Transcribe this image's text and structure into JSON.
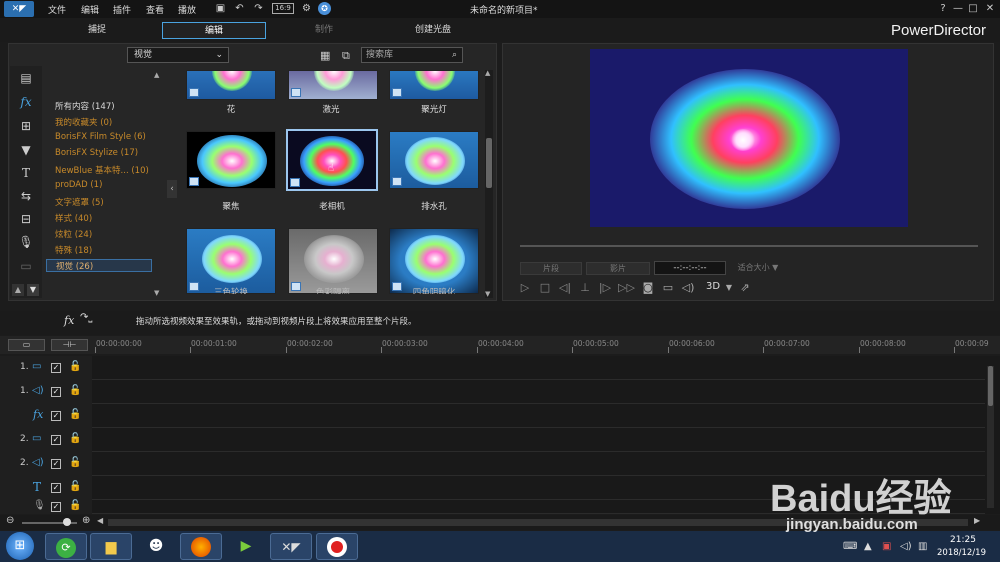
{
  "menu": [
    "文件",
    "编辑",
    "插件",
    "查看",
    "播放"
  ],
  "project_title": "未命名的新项目*",
  "window_buttons": [
    "?",
    "—",
    "□",
    "✕"
  ],
  "mode_tabs": [
    "捕捉",
    "编辑",
    "制作",
    "创建光盘"
  ],
  "brand": "PowerDirector",
  "library": {
    "dropdown": "视觉",
    "search_placeholder": "搜索库",
    "categories": [
      {
        "label": "所有内容 (147)"
      },
      {
        "label": "我的收藏夹 (0)"
      },
      {
        "label": "BorisFX Film Style (6)"
      },
      {
        "label": "BorisFX Stylize (17)"
      },
      {
        "label": "NewBlue 基本特... (10)"
      },
      {
        "label": "proDAD (1)"
      },
      {
        "label": "文字遮罩 (5)"
      },
      {
        "label": "样式 (40)"
      },
      {
        "label": "炫粒 (24)"
      },
      {
        "label": "特殊 (18)"
      },
      {
        "label": "视觉 (26)"
      }
    ],
    "thumbs": [
      {
        "label": "花"
      },
      {
        "label": "激光"
      },
      {
        "label": "聚光灯"
      },
      {
        "label": "聚焦"
      },
      {
        "label": "老相机"
      },
      {
        "label": "排水孔"
      },
      {
        "label": "三色轮换"
      },
      {
        "label": "色彩隔离"
      },
      {
        "label": "四角阴暗化"
      }
    ]
  },
  "preview": {
    "btn_clip": "片段",
    "btn_movie": "影片",
    "timecode": "--:--:--:--",
    "fit": "适合大小 ▼",
    "label_3d": "3D"
  },
  "hint": "拖动所选视频效果至效果轨，或拖动到视频片段上将效果应用至整个片段。",
  "timeline": {
    "times": [
      "00:00:00:00",
      "00:00:01:00",
      "00:00:02:00",
      "00:00:03:00",
      "00:00:04:00",
      "00:00:05:00",
      "00:00:06:00",
      "00:00:07:00",
      "00:00:08:00",
      "00:00:09"
    ],
    "tracks": [
      {
        "num": "1."
      },
      {
        "num": "1."
      },
      {
        "num": ""
      },
      {
        "num": "2."
      },
      {
        "num": "2."
      },
      {
        "num": ""
      },
      {
        "num": ""
      }
    ]
  },
  "taskbar": {
    "time": "21:25",
    "date": "2018/12/19"
  },
  "watermark": {
    "logo": "Baidu经验",
    "url": "jingyan.baidu.com"
  }
}
